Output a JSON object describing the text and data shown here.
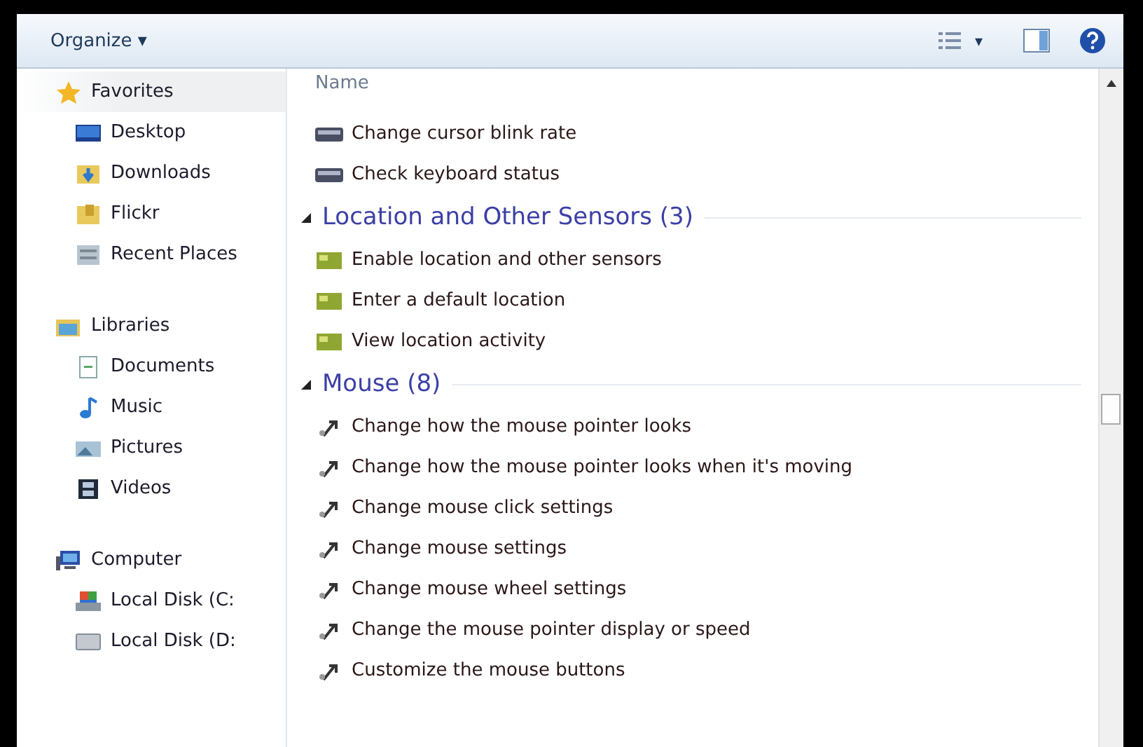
{
  "toolbar": {
    "organize": "Organize ▾",
    "view_caret": "▾"
  },
  "sidebar": {
    "groups": [
      {
        "label": "Favorites",
        "kind": "star",
        "highlighted": true,
        "items": [
          {
            "label": "Desktop",
            "kind": "desktop"
          },
          {
            "label": "Downloads",
            "kind": "download"
          },
          {
            "label": "Flickr",
            "kind": "folder"
          },
          {
            "label": "Recent Places",
            "kind": "recent"
          }
        ]
      },
      {
        "label": "Libraries",
        "kind": "library",
        "highlighted": false,
        "items": [
          {
            "label": "Documents",
            "kind": "document"
          },
          {
            "label": "Music",
            "kind": "music"
          },
          {
            "label": "Pictures",
            "kind": "pictures"
          },
          {
            "label": "Videos",
            "kind": "video"
          }
        ]
      },
      {
        "label": "Computer",
        "kind": "computer",
        "highlighted": false,
        "items": [
          {
            "label": "Local Disk (C:",
            "kind": "system"
          },
          {
            "label": "Local Disk (D:",
            "kind": "disk"
          }
        ]
      }
    ]
  },
  "content": {
    "column_header": "Name",
    "sections": [
      {
        "kind": "keyboard",
        "items": [
          "Change cursor blink rate",
          "Check keyboard status"
        ]
      },
      {
        "heading": "Location and Other Sensors (3)",
        "expanded": true,
        "kind": "sensor",
        "items": [
          "Enable location and other sensors",
          "Enter a default location",
          "View location activity"
        ]
      },
      {
        "heading": "Mouse (8)",
        "expanded": true,
        "kind": "mouse",
        "items": [
          "Change how the mouse pointer looks",
          "Change how the mouse pointer looks when it's moving",
          "Change mouse click settings",
          "Change mouse settings",
          "Change mouse wheel settings",
          "Change the mouse pointer display or speed",
          "Customize the mouse buttons"
        ]
      }
    ]
  }
}
